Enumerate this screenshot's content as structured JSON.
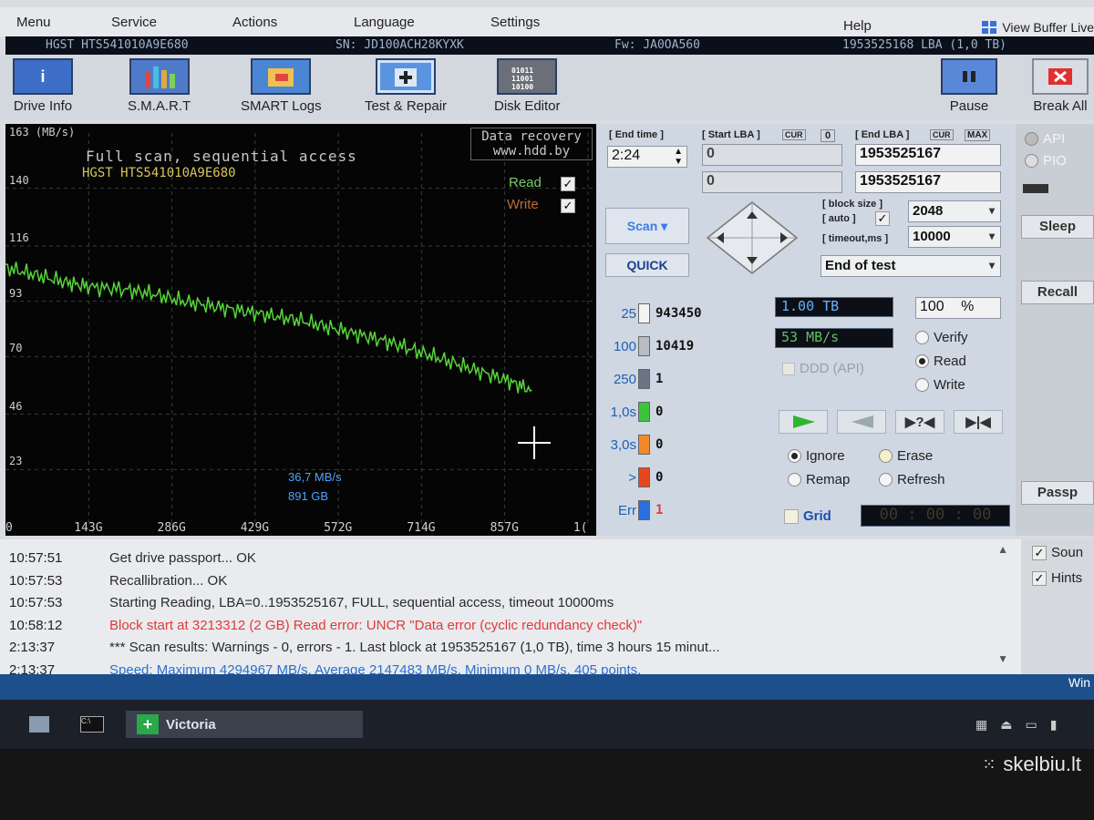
{
  "menu": [
    "Menu",
    "Service",
    "Actions",
    "Language",
    "Settings",
    "Help"
  ],
  "view_buffer_label": "View Buffer Live",
  "info": {
    "model": "HGST HTS541010A9E680",
    "serial": "SN: JD100ACH28KYXK",
    "firmware": "Fw: JA0OA560",
    "lba": "1953525168 LBA (1,0 TB)"
  },
  "toolbar": [
    {
      "label": "Drive Info",
      "icon": "info-icon"
    },
    {
      "label": "S.M.A.R.T",
      "icon": "smart-icon"
    },
    {
      "label": "SMART Logs",
      "icon": "logs-icon"
    },
    {
      "label": "Test & Repair",
      "icon": "repair-icon"
    },
    {
      "label": "Disk Editor",
      "icon": "editor-icon"
    }
  ],
  "toolbar_right": {
    "pause": "Pause",
    "break": "Break All"
  },
  "graph": {
    "title": "Full scan, sequential access",
    "model": "HGST HTS541010A9E680",
    "recovery_line1": "Data recovery",
    "recovery_line2": "www.hdd.by",
    "read_label": "Read",
    "write_label": "Write",
    "speed": "36,7 MB/s",
    "position": "891 GB",
    "y_top": "163 (MB/s)"
  },
  "chart_data": {
    "type": "line",
    "ylim": [
      0,
      163
    ],
    "yticks": [
      "140",
      "116",
      "93",
      "70",
      "46",
      "23"
    ],
    "xticks": [
      "0",
      "143G",
      "286G",
      "429G",
      "572G",
      "714G",
      "857G",
      "1("
    ],
    "series": [
      {
        "name": "Read",
        "x": [
          0,
          50,
          100,
          143,
          200,
          250,
          300,
          350,
          400,
          450,
          500,
          550,
          600,
          650,
          700,
          750,
          800,
          850,
          891
        ],
        "y": [
          107,
          104,
          101,
          99,
          98,
          96,
          93,
          91,
          89,
          87,
          85,
          82,
          79,
          76,
          72,
          68,
          64,
          60,
          56
        ]
      }
    ]
  },
  "panel": {
    "end_time_label": "[ End time ]",
    "end_time": "2:24",
    "start_lba_label": "[ Start LBA ]",
    "cur": "CUR",
    "zero": "0",
    "end_lba_label": "[ End LBA ]",
    "max": "MAX",
    "start_lba": "0",
    "start_lba2": "0",
    "end_lba": "1953525167",
    "end_lba2": "1953525167",
    "scan": "Scan",
    "quick": "QUICK",
    "block_size_label": "[ block size ]",
    "auto_label": "[ auto ]",
    "timeout_label": "[ timeout,ms ]",
    "block_size": "2048",
    "timeout": "10000",
    "end_of_test": "End of test",
    "blocks": [
      {
        "label": "25",
        "value": "943450",
        "color": "#f4f4f4"
      },
      {
        "label": "100",
        "value": "10419",
        "color": "#b8bcc4"
      },
      {
        "label": "250",
        "value": "1",
        "color": "#6c7484"
      },
      {
        "label": "1,0s",
        "value": "0",
        "color": "#3cc43c"
      },
      {
        "label": "3,0s",
        "value": "0",
        "color": "#f08a2a"
      },
      {
        "label": ">",
        "value": "0",
        "color": "#e8461e"
      },
      {
        "label": "Err",
        "value": "1",
        "color": "#2a6fe0"
      }
    ],
    "size_done": "1.00 TB",
    "percent": "100",
    "percent_sign": "%",
    "speed": "53 MB/s",
    "ddd": "DDD (API)",
    "verify": "Verify",
    "read": "Read",
    "write": "Write",
    "ignore": "Ignore",
    "erase": "Erase",
    "remap": "Remap",
    "refresh": "Refresh",
    "grid": "Grid",
    "timer": "00 : 00 : 00"
  },
  "side": {
    "api": "API",
    "pio": "PIO",
    "sleep": "Sleep",
    "recall": "Recall",
    "passp": "Passp",
    "sound": "Soun",
    "hints": "Hints"
  },
  "log": [
    {
      "time": "10:57:51",
      "msg": "Get drive passport... OK",
      "kind": "normal"
    },
    {
      "time": "10:57:53",
      "msg": "Recallibration... OK",
      "kind": "normal"
    },
    {
      "time": "10:57:53",
      "msg": "Starting Reading, LBA=0..1953525167, FULL, sequential access, timeout 10000ms",
      "kind": "normal"
    },
    {
      "time": "10:58:12",
      "msg": "Block start at 3213312 (2 GB) Read error: UNCR \"Data error (cyclic redundancy check)\"",
      "kind": "red"
    },
    {
      "time": "2:13:37",
      "msg": "*** Scan results: Warnings - 0, errors - 1. Last block at 1953525167 (1,0 TB), time 3 hours 15 minut...",
      "kind": "normal"
    },
    {
      "time": "2:13:37",
      "msg": "Speed: Maximum 4294967 MB/s. Average 2147483 MB/s. Minimum 0 MB/s. 405 points.",
      "kind": "blue"
    }
  ],
  "status_right": "Win",
  "taskbar": {
    "victoria": "Victoria"
  },
  "watermark": "skelbiu.lt"
}
